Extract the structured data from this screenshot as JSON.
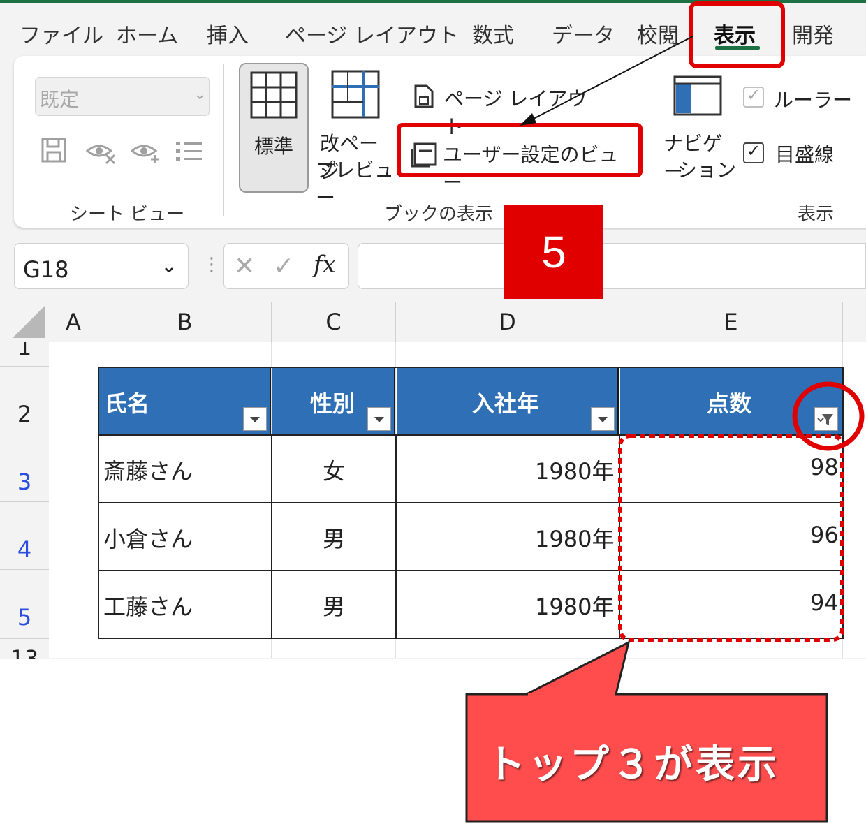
{
  "ribbon_tabs": [
    "ファイル",
    "ホーム",
    "挿入",
    "ページ レイアウト",
    "数式",
    "データ",
    "校閲",
    "表示",
    "開発"
  ],
  "active_tab": "表示",
  "sheet_view": {
    "style_select": "既定",
    "group_label": "シート ビュー"
  },
  "book_view": {
    "normal_label": "標準",
    "page_break_line1": "改ページ",
    "page_break_line2": "プレビュー",
    "page_layout_label": "ページ レイアウト",
    "custom_view_label": "ユーザー設定のビュー",
    "group_label": "ブックの表示"
  },
  "show": {
    "nav_line1": "ナビゲー",
    "nav_line2": "ション",
    "ruler_label": "ルーラー",
    "gridlines_label": "目盛線",
    "group_label": "表示"
  },
  "name_box": "G18",
  "formula_fx": "fx",
  "step_badge": "5",
  "columns": [
    "A",
    "B",
    "C",
    "D",
    "E"
  ],
  "row_numbers": [
    "1",
    "2",
    "3",
    "4",
    "5",
    "13"
  ],
  "table": {
    "headers": [
      "氏名",
      "性別",
      "入社年",
      "点数"
    ],
    "rows": [
      [
        "斎藤さん",
        "女",
        "1980年",
        "98"
      ],
      [
        "小倉さん",
        "男",
        "1980年",
        "96"
      ],
      [
        "工藤さん",
        "男",
        "1980年",
        "94"
      ]
    ]
  },
  "callout_text": "トップ３が表示",
  "colors": {
    "header_blue": "#2e6fb5",
    "excel_green": "#1e7145",
    "highlight_red": "#e00000",
    "callout_red": "#ff4d4d"
  }
}
